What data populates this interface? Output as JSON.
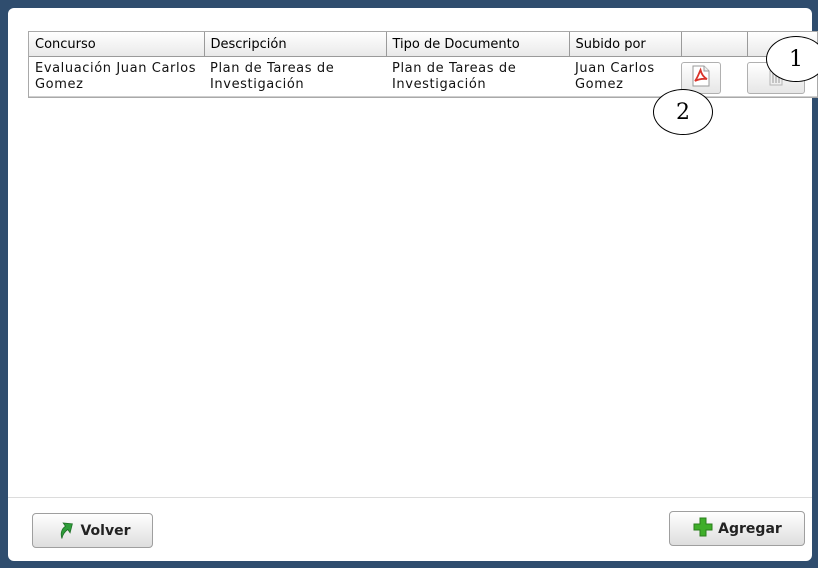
{
  "grid": {
    "columns": [
      "Concurso",
      "Descripción",
      "Tipo de Documento",
      "Subido por",
      "",
      ""
    ],
    "rows": [
      {
        "concurso": "Evaluación Juan Carlos Gomez",
        "descripcion": "Plan de Tareas de Investigación",
        "tipo": "Plan de Tareas de Investigación",
        "subido": "Juan Carlos Gomez",
        "actions": [
          "pdf-icon",
          "trash-icon"
        ]
      }
    ]
  },
  "footer": {
    "back_label": "Volver",
    "add_label": "Agregar"
  },
  "callouts": [
    "1",
    "2"
  ],
  "colors": {
    "background": "#2f4d6e",
    "panel": "#ffffff",
    "pdf_red": "#d9342b",
    "add_green": "#3fae2a",
    "back_green": "#2e9e3a"
  }
}
